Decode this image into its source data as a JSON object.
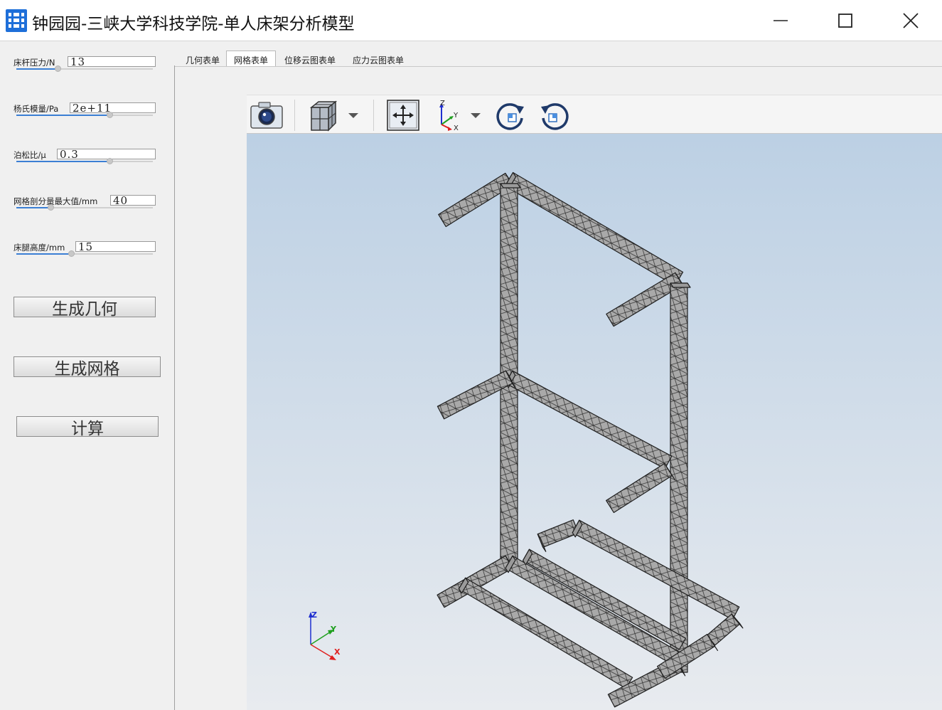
{
  "window": {
    "title": "钟园园-三峡大学科技学院-单人床架分析模型",
    "controls": {
      "minimize": "minimize",
      "maximize": "maximize",
      "close": "close"
    }
  },
  "params": [
    {
      "label": "床杆压力/N",
      "value": "13",
      "fraction": 0.3
    },
    {
      "label": "杨氏模量/Pa",
      "value": "2e+11",
      "fraction": 0.68
    },
    {
      "label": "泊松比/μ",
      "value": "0.3",
      "fraction": 0.68
    },
    {
      "label": "网格剖分量最大值/mm",
      "value": "40",
      "fraction": 0.25
    },
    {
      "label": "床腿高度/mm",
      "value": "15",
      "fraction": 0.4
    }
  ],
  "buttons": {
    "generate_geometry": "生成几何",
    "generate_mesh": "生成网格",
    "compute": "计算"
  },
  "tabs": [
    {
      "label": "几何表单",
      "active": false
    },
    {
      "label": "网格表单",
      "active": true
    },
    {
      "label": "位移云图表单",
      "active": false
    },
    {
      "label": "应力云图表单",
      "active": false
    }
  ],
  "toolbar": {
    "icons": [
      "camera-icon",
      "view-cube-icon",
      "dropdown-arrow-icon",
      "fit-view-icon",
      "axes-icon",
      "dropdown-arrow-icon",
      "rotate-cw-icon",
      "rotate-ccw-icon"
    ],
    "axes_labels": {
      "x": "X",
      "y": "Y",
      "z": "Z"
    }
  },
  "viewport": {
    "triad": {
      "x": "X",
      "y": "Y",
      "z": "Z"
    },
    "colors": {
      "x": "#e02020",
      "y": "#20a020",
      "z": "#2030d0",
      "mesh_fill": "#a9a9a9",
      "mesh_edge": "#222222"
    }
  }
}
